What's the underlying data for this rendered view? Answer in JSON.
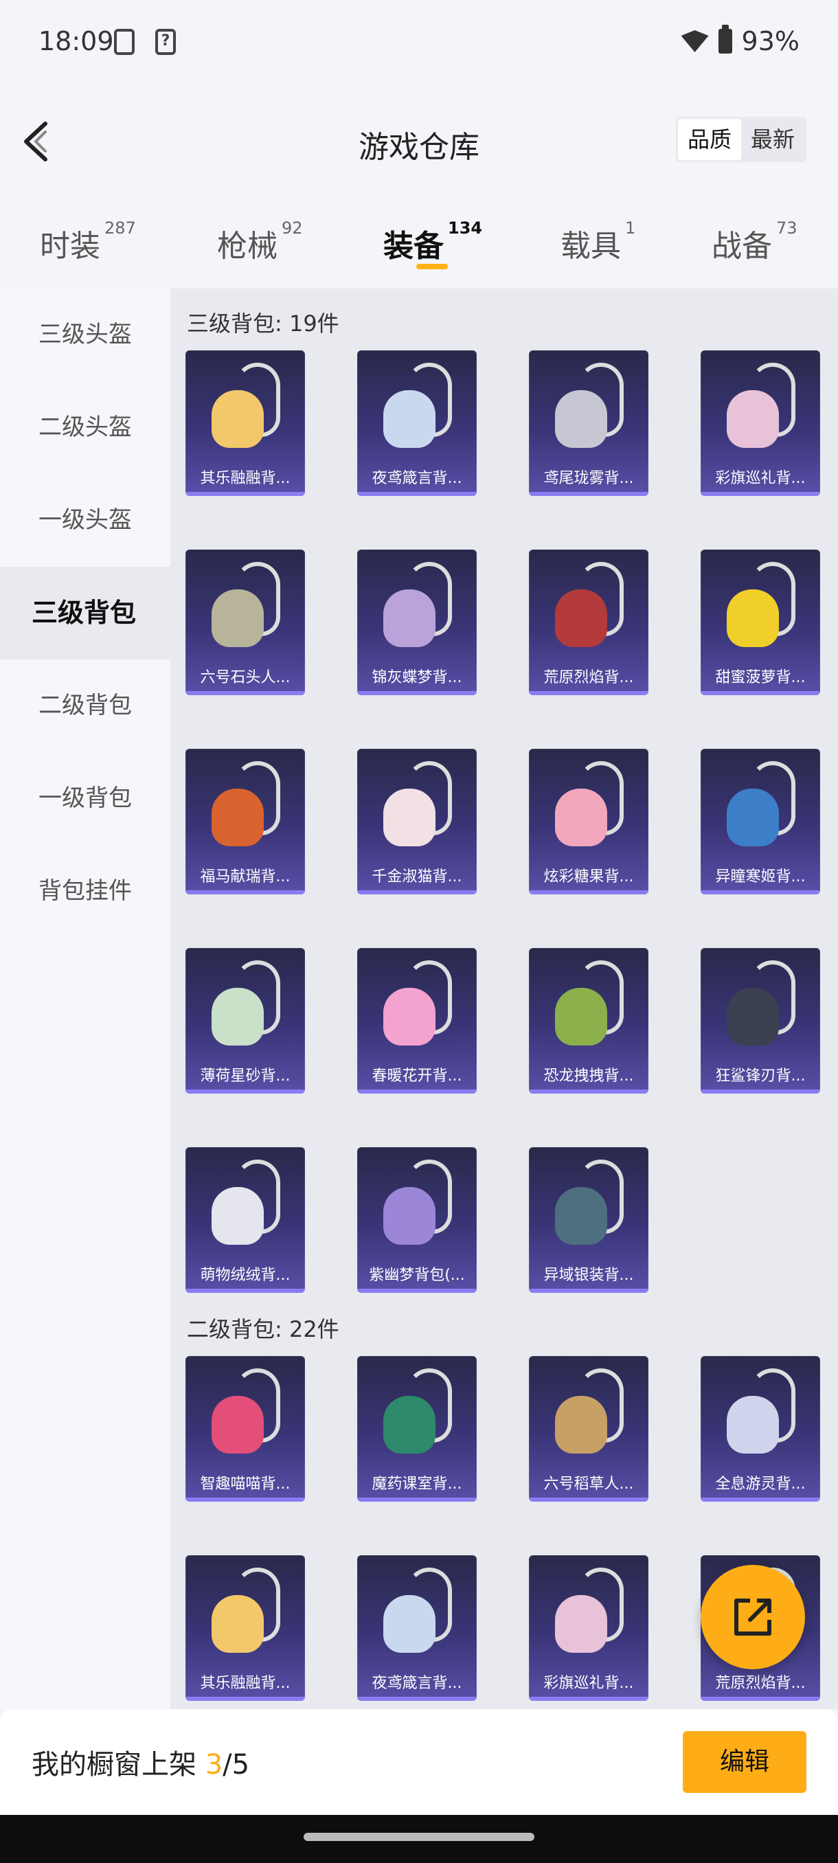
{
  "status": {
    "time": "18:09",
    "battery": "93%",
    "unknown_icon_glyph": "?"
  },
  "header": {
    "title": "游戏仓库",
    "sort_options": [
      "品质",
      "最新"
    ],
    "sort_active": "品质"
  },
  "tabs": [
    {
      "label": "时装",
      "count": "287"
    },
    {
      "label": "枪械",
      "count": "92"
    },
    {
      "label": "装备",
      "count": "134",
      "active": true
    },
    {
      "label": "载具",
      "count": "1"
    },
    {
      "label": "战备",
      "count": "73"
    }
  ],
  "sidebar": {
    "items": [
      "三级头盔",
      "二级头盔",
      "一级头盔",
      "三级背包",
      "二级背包",
      "一级背包",
      "背包挂件"
    ],
    "active": "三级背包"
  },
  "sections": [
    {
      "title": "三级背包: 19件",
      "items": [
        {
          "name": "其乐融融背...",
          "color": "#f2c86a"
        },
        {
          "name": "夜鸢箴言背...",
          "color": "#c9d8ef"
        },
        {
          "name": "鸢尾珑雾背...",
          "color": "#c7c7d4"
        },
        {
          "name": "彩旗巡礼背...",
          "color": "#e7c2d9"
        },
        {
          "name": "六号石头人...",
          "color": "#b8b49a"
        },
        {
          "name": "锦灰蝶梦背...",
          "color": "#b9a3d8"
        },
        {
          "name": "荒原烈焰背...",
          "color": "#b33b3b"
        },
        {
          "name": "甜蜜菠萝背...",
          "color": "#f0cf2a"
        },
        {
          "name": "福马献瑞背...",
          "color": "#d8632e"
        },
        {
          "name": "千金淑猫背...",
          "color": "#f1e0e4"
        },
        {
          "name": "炫彩糖果背...",
          "color": "#f2a7bc"
        },
        {
          "name": "异瞳寒姬背...",
          "color": "#3c7fc8"
        },
        {
          "name": "薄荷星砂背...",
          "color": "#c9e0c9"
        },
        {
          "name": "春暖花开背...",
          "color": "#f4a2d0"
        },
        {
          "name": "恐龙拽拽背...",
          "color": "#8bb04c"
        },
        {
          "name": "狂鲨锋刃背...",
          "color": "#3b4150"
        },
        {
          "name": "萌物绒绒背...",
          "color": "#e5e5ee"
        },
        {
          "name": "紫幽梦背包(...",
          "color": "#9b86d8"
        },
        {
          "name": "异域银装背...",
          "color": "#4e6f7f"
        }
      ]
    },
    {
      "title": "二级背包: 22件",
      "items": [
        {
          "name": "智趣喵喵背...",
          "color": "#e44f7a"
        },
        {
          "name": "魔药课室背...",
          "color": "#2e8a6a"
        },
        {
          "name": "六号稻草人...",
          "color": "#c6a064"
        },
        {
          "name": "全息游灵背...",
          "color": "#cfd4ec"
        },
        {
          "name": "其乐融融背...",
          "color": "#f2c86a"
        },
        {
          "name": "夜鸢箴言背...",
          "color": "#c9d8ef"
        },
        {
          "name": "彩旗巡礼背...",
          "color": "#e7c2d9"
        },
        {
          "name": "荒原烈焰背...",
          "color": "#b33b3b"
        }
      ]
    }
  ],
  "bottom": {
    "label": "我的橱窗上架 ",
    "current": "3",
    "total": "/5",
    "edit_label": "编辑"
  },
  "colors": {
    "accent": "#ffad16",
    "card_top": "#29294a",
    "card_bottom": "#5a4fa8"
  }
}
